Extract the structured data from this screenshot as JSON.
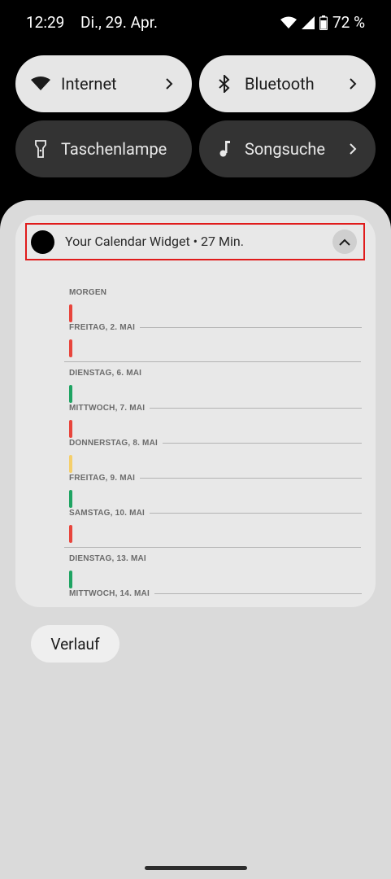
{
  "status_bar": {
    "time": "12:29",
    "date": "Di., 29. Apr.",
    "battery": "72 %",
    "icons": [
      "wifi-icon",
      "cell-signal-icon",
      "battery-icon"
    ]
  },
  "quick_tiles": [
    {
      "label": "Internet",
      "icon": "wifi-icon",
      "state": "active",
      "has_chevron": true
    },
    {
      "label": "Bluetooth",
      "icon": "bluetooth-icon",
      "state": "active",
      "has_chevron": true
    },
    {
      "label": "Taschenlampe",
      "icon": "flashlight-icon",
      "state": "inactive",
      "has_chevron": false
    },
    {
      "label": "Songsuche",
      "icon": "music-note-icon",
      "state": "inactive",
      "has_chevron": true
    }
  ],
  "notification": {
    "app_title": "Your Calendar Widget",
    "separator": "•",
    "age": "27 Min.",
    "expand_icon": "chevron-up-icon",
    "days": [
      {
        "label": "MORGEN",
        "event_color": "#e8453c"
      },
      {
        "label": "FREITAG, 2. MAI",
        "event_color": "#e8453c"
      },
      {
        "label": "DIENSTAG, 6. MAI",
        "event_color": "#1fa463"
      },
      {
        "label": "MITTWOCH, 7. MAI",
        "event_color": "#e8453c"
      },
      {
        "label": "DONNERSTAG, 8. MAI",
        "event_color": "#f5cf6b"
      },
      {
        "label": "FREITAG, 9. MAI",
        "event_color": "#1fa463"
      },
      {
        "label": "SAMSTAG, 10. MAI",
        "event_color": "#e8453c"
      },
      {
        "label": "DIENSTAG, 13. MAI",
        "event_color": "#1fa463"
      },
      {
        "label": "MITTWOCH, 14. MAI",
        "event_color": null
      }
    ]
  },
  "history_button": {
    "label": "Verlauf"
  },
  "colors": {
    "background": "#000000",
    "shade": "#dadada",
    "card": "#e8e8e8",
    "tile_active": "#e6e6e6",
    "tile_inactive": "#333333",
    "highlight": "#e01b1b"
  }
}
